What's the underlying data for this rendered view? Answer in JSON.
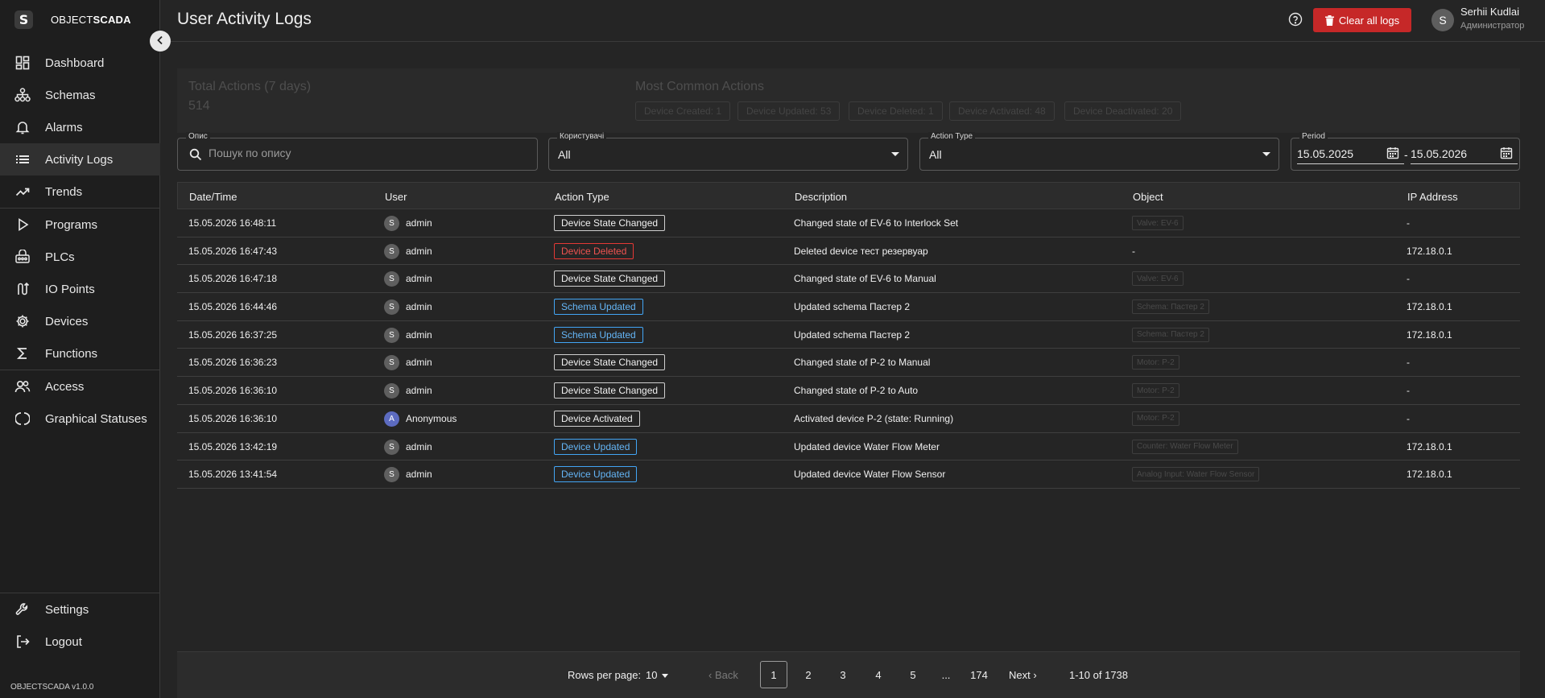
{
  "brand": {
    "logo_letter": "S",
    "name_prefix": "OBJECT",
    "name_suffix": "SCADA",
    "version": "OBJECTSCADA v1.0.0"
  },
  "sidebar": {
    "items": [
      {
        "label": "Dashboard",
        "icon": "dashboard-icon"
      },
      {
        "label": "Schemas",
        "icon": "schema-icon"
      },
      {
        "label": "Alarms",
        "icon": "bell-icon"
      },
      {
        "label": "Activity Logs",
        "icon": "list-icon",
        "active": true
      },
      {
        "label": "Trends",
        "icon": "trend-icon"
      },
      {
        "label": "Programs",
        "icon": "play-icon"
      },
      {
        "label": "PLCs",
        "icon": "plc-icon"
      },
      {
        "label": "IO Points",
        "icon": "io-points-icon"
      },
      {
        "label": "Devices",
        "icon": "gear-icon"
      },
      {
        "label": "Functions",
        "icon": "sigma-icon"
      },
      {
        "label": "Access",
        "icon": "users-icon"
      },
      {
        "label": "Graphical Statuses",
        "icon": "status-icon"
      }
    ],
    "bottom": [
      {
        "label": "Settings",
        "icon": "wrench-icon"
      },
      {
        "label": "Logout",
        "icon": "logout-icon"
      }
    ]
  },
  "header": {
    "title": "User Activity Logs",
    "clear_button": "Clear all logs",
    "user": {
      "initial": "S",
      "name": "Serhii Kudlai",
      "role": "Администратор"
    }
  },
  "stats": {
    "total_label": "Total Actions (7 days)",
    "total_value": "514",
    "common_label": "Most Common Actions",
    "common": [
      "Device Created: 1",
      "Device Updated: 53",
      "Device Deleted: 1",
      "Device Activated: 48",
      "Device Deactivated: 20"
    ]
  },
  "filters": {
    "description": {
      "legend": "Опис",
      "placeholder": "Пошук по опису"
    },
    "users": {
      "legend": "Користувачі",
      "value": "All"
    },
    "action_type": {
      "legend": "Action Type",
      "value": "All"
    },
    "period": {
      "legend": "Period",
      "from": "15.05.2025",
      "separator": "-",
      "to": "15.05.2026"
    }
  },
  "table": {
    "headers": [
      "Date/Time",
      "User",
      "Action Type",
      "Description",
      "Object",
      "IP Address"
    ],
    "rows": [
      {
        "datetime": "15.05.2026 16:48:11",
        "initial": "S",
        "user": "admin",
        "action": "Device State Changed",
        "action_style": "default",
        "description": "Changed state of EV-6 to Interlock Set",
        "object": "Valve: EV-6",
        "ip": "-"
      },
      {
        "datetime": "15.05.2026 16:47:43",
        "initial": "S",
        "user": "admin",
        "action": "Device Deleted",
        "action_style": "red",
        "description": "Deleted device тест резервуар",
        "object": "-",
        "ip": "172.18.0.1"
      },
      {
        "datetime": "15.05.2026 16:47:18",
        "initial": "S",
        "user": "admin",
        "action": "Device State Changed",
        "action_style": "default",
        "description": "Changed state of EV-6 to Manual",
        "object": "Valve: EV-6",
        "ip": "-"
      },
      {
        "datetime": "15.05.2026 16:44:46",
        "initial": "S",
        "user": "admin",
        "action": "Schema Updated",
        "action_style": "blue",
        "description": "Updated schema Пастер 2",
        "object": "Schema: Пастер 2",
        "ip": "172.18.0.1"
      },
      {
        "datetime": "15.05.2026 16:37:25",
        "initial": "S",
        "user": "admin",
        "action": "Schema Updated",
        "action_style": "blue",
        "description": "Updated schema Пастер 2",
        "object": "Schema: Пастер 2",
        "ip": "172.18.0.1"
      },
      {
        "datetime": "15.05.2026 16:36:23",
        "initial": "S",
        "user": "admin",
        "action": "Device State Changed",
        "action_style": "default",
        "description": "Changed state of P-2 to Manual",
        "object": "Motor: P-2",
        "ip": "-"
      },
      {
        "datetime": "15.05.2026 16:36:10",
        "initial": "S",
        "user": "admin",
        "action": "Device State Changed",
        "action_style": "default",
        "description": "Changed state of P-2 to Auto",
        "object": "Motor: P-2",
        "ip": "-"
      },
      {
        "datetime": "15.05.2026 16:36:10",
        "initial": "A",
        "user": "Anonymous",
        "action": "Device Activated",
        "action_style": "default",
        "description": "Activated device P-2 (state: Running)",
        "object": "Motor: P-2",
        "ip": "-"
      },
      {
        "datetime": "15.05.2026 13:42:19",
        "initial": "S",
        "user": "admin",
        "action": "Device Updated",
        "action_style": "blue",
        "description": "Updated device Water Flow Meter",
        "object": "Counter: Water Flow Meter",
        "ip": "172.18.0.1"
      },
      {
        "datetime": "15.05.2026 13:41:54",
        "initial": "S",
        "user": "admin",
        "action": "Device Updated",
        "action_style": "blue",
        "description": "Updated device Water Flow Sensor",
        "object": "Analog Input: Water Flow Sensor",
        "ip": "172.18.0.1"
      }
    ]
  },
  "pagination": {
    "rows_per_page_label": "Rows per page:",
    "rows_per_page": "10",
    "back": "Back",
    "pages": [
      "1",
      "2",
      "3",
      "4",
      "5",
      "...",
      "174"
    ],
    "current": "1",
    "next": "Next",
    "range": "1-10 of 1738"
  },
  "colors": {
    "accent_red": "#c62828",
    "badge_blue": "#42a5f5",
    "badge_red": "#e53935",
    "background": "#252525",
    "sidebar": "#1e1e1e"
  }
}
